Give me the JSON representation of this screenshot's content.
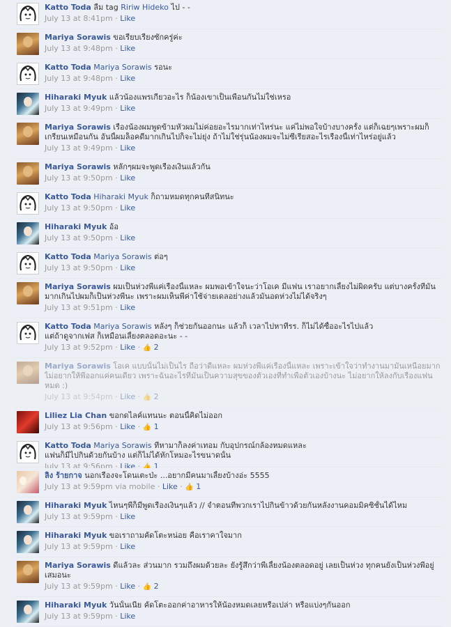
{
  "comments": [
    {
      "author": "Katto Toda",
      "tag": "",
      "text": "ลืม tag ",
      "tag2": "Ririw Hideko",
      "text2": " ไป - -",
      "time": "July 13 at 8:41pm",
      "via": "",
      "like": "Like",
      "likes": "",
      "avatar": "katto"
    },
    {
      "author": "Mariya Sorawis",
      "tag": "",
      "text": "ขอเรียบเรียงซักครู่ค่ะ",
      "tag2": "",
      "text2": "",
      "time": "July 13 at 9:48pm",
      "via": "",
      "like": "Like",
      "likes": "",
      "avatar": "mariya"
    },
    {
      "author": "Katto Toda",
      "tag": "Mariya Sorawis",
      "text": " รอนะ",
      "tag2": "",
      "text2": "",
      "time": "July 13 at 9:48pm",
      "via": "",
      "like": "Like",
      "likes": "",
      "avatar": "katto"
    },
    {
      "author": "Hiharaki Myuk",
      "tag": "",
      "text": "แล้วน้องแพรเกี่ยวอะไร ก็น้องเขาเป็นเพื่อนกันไม่ใช่เหรอ",
      "tag2": "",
      "text2": "",
      "time": "July 13 at 9:49pm",
      "via": "",
      "like": "Like",
      "likes": "",
      "avatar": "hiharaki"
    },
    {
      "author": "Mariya Sorawis",
      "tag": "",
      "text": "เรื่องน้องผมพูดข้ามหัวผมไม่ค่อยอะไรมากเท่าไหร่นะ แค่ไม่พอใจบ้างบางครั้ง แต่ก็เฉยๆเพราะผมก็",
      "line2": "เกรียนเหมือนกัน อันนี้ผมล็อคดีมากเกินไปก็จะไม่ยุ่ง ถ้าไม่ใช่รุ่นน้องผมจะไม่ซีเรียสอะไรเรื่องนี้เท่าไหร่อยู่แล้ว",
      "tag2": "",
      "text2": "",
      "time": "July 13 at 9:49pm",
      "via": "",
      "like": "Like",
      "likes": "",
      "avatar": "mariya"
    },
    {
      "author": "Mariya Sorawis",
      "tag": "",
      "text": "หลักๆผมจะพูดเรื่องเงินแล้วกัน",
      "tag2": "",
      "text2": "",
      "time": "July 13 at 9:50pm",
      "via": "",
      "like": "Like",
      "likes": "",
      "avatar": "mariya"
    },
    {
      "author": "Katto Toda",
      "tag": "Hiharaki Myuk",
      "text": " ก็ถามหมดทุกคนที่สนิทนะ",
      "tag2": "",
      "text2": "",
      "time": "July 13 at 9:50pm",
      "via": "",
      "like": "Like",
      "likes": "",
      "avatar": "katto"
    },
    {
      "author": "Hiharaki Myuk",
      "tag": "",
      "text": "อ้อ",
      "tag2": "",
      "text2": "",
      "time": "July 13 at 9:50pm",
      "via": "",
      "like": "Like",
      "likes": "",
      "avatar": "hiharaki"
    },
    {
      "author": "Katto Toda",
      "tag": "Mariya Sorawis",
      "text": " ต่อๆ",
      "tag2": "",
      "text2": "",
      "time": "July 13 at 9:50pm",
      "via": "",
      "like": "Like",
      "likes": "",
      "avatar": "katto"
    },
    {
      "author": "Mariya Sorawis",
      "tag": "",
      "text": "ผมเป็นห่วงพี่แค่เรื่องนี้แหละ ผมพอเข้าใจนะว่าโอเค มีแฟน เราอยากเลี้ยงไม่ผิดครับ แต่บางครั้งที่มัน",
      "line2": "มากเกินไปผมก็เป็นห่วงพี่นะ เพราะผมเห็นพี่ค่าใช้จ่ายเดลอย่างแล้วมันอดห่วงไม่ได้จริงๆ",
      "tag2": "",
      "text2": "",
      "time": "July 13 at 9:51pm",
      "via": "",
      "like": "Like",
      "likes": "",
      "avatar": "mariya"
    },
    {
      "author": "Katto Toda",
      "tag": "Mariya Sorawis",
      "text": " หลังๆ ก็ช่วยกันออกนะ แล้วก็ เวลาไปหาที่รร. ก็ไม่ได้ซื้ออะไรไปแล้ว",
      "line2": "แต่ถ้าดูจากเฟส ก็เหมือนเลี้ยงตลอดอะนะ - -",
      "tag2": "",
      "text2": "",
      "time": "July 13 at 9:52pm",
      "via": "",
      "like": "Like",
      "likes": "2",
      "avatar": "katto"
    },
    {
      "author": "Mariya Sorawis",
      "tag": "",
      "text": "โอเค แบบนั้นไม่เป็นไร ถือว่าดีแหละ ผมห่วงพี่แค่เรื่องนี้แหละ เพราะเข้าใจว่าทำงานมามันเหนื่อยมาก",
      "line2": "ไม่อยากให้พี่ออกแค่คนเดียว เพราะฉันอะไรที่มันเป็นความสุขของตัวเองที่ทำเพื่อตัวเองบ้างนะ ไม่อยากให้ลงกับเรื่องแฟน",
      "line3": "หมด :)",
      "tag2": "",
      "text2": "",
      "time": "July 13 at 9:54pm",
      "via": "",
      "like": "Like",
      "likes": "2",
      "avatar": "mariya"
    },
    {
      "author": "Liliez Lia Chan",
      "tag": "",
      "text": "ขอกดไลค์แทนนะ ตอนนี้คิดไม่ออก",
      "tag2": "",
      "text2": "",
      "time": "July 13 at 9:56pm",
      "via": "",
      "like": "Like",
      "likes": "1",
      "avatar": "liliez"
    },
    {
      "author": "Katto Toda",
      "tag": "Mariya Sorawis",
      "text": " ที่หามาก็ลงค่าเทอม กับอุปกรณ์กล้องหมดแหละ",
      "line2": "แฟนก็มีไปกินด้วยกันบ้าง แต่ก็ไม่ได้หักโหมอะไรขนาดนั้น",
      "tag2": "",
      "text2": "",
      "time": "July 13 at 9:56pm",
      "via": "",
      "like": "Like",
      "likes": "1",
      "avatar": "katto"
    },
    {
      "author": "ลิง ร้ายกาจ",
      "tag": "",
      "text": "นอกเรื่องจะโดนเตะป่ะ ...อยากมีคนมาเลี้ยงบ้างอ่ะ 5555",
      "tag2": "",
      "text2": "",
      "time": "July 13 at 9:59pm",
      "via": "via mobile",
      "like": "Like",
      "likes": "1",
      "avatar": "ling"
    },
    {
      "author": "Hiharaki Myuk",
      "tag": "",
      "text": "ไหนๆพี่ก็มีพูดเรื่องเงินๆแล้ว // จำตอนที่พวกเราไปกินข้าวด้วยกันหลังงานคอมมิคซิชั้นได้ไหม",
      "tag2": "",
      "text2": "",
      "time": "July 13 at 9:59pm",
      "via": "",
      "like": "Like",
      "likes": "",
      "avatar": "hiharaki"
    },
    {
      "author": "Hiharaki Myuk",
      "tag": "",
      "text": "ขอเราถามคัดโตะหน่อย คือเราคาใจมาก",
      "tag2": "",
      "text2": "",
      "time": "July 13 at 9:59pm",
      "via": "",
      "like": "Like",
      "likes": "",
      "avatar": "hiharaki"
    },
    {
      "author": "Mariya Sorawis",
      "tag": "",
      "text": "ดีแล้วละ ส่วนมาก รวมถึงผมด้วยละ ยังรู้สึกว่าพี่เลี้ยงน้องตลอดอยู่ เลยเป็นห่วง ทุกคนยังเป็นห่วงพี่อยู่",
      "line2": "เสมอนะ",
      "tag2": "",
      "text2": "",
      "time": "July 13 at 9:59pm",
      "via": "",
      "like": "Like",
      "likes": "2",
      "avatar": "mariya"
    },
    {
      "author": "Hiharaki Myuk",
      "tag": "",
      "text": "วันนั้นเนี่ย คัดโตะออกค่าอาหารให้น้องหมดเลยหรือเปล่า หรือแบ่งๆกันออก",
      "tag2": "",
      "text2": "",
      "time": "July 13 at 9:59pm",
      "via": "",
      "like": "Like",
      "likes": "",
      "avatar": "hiharaki"
    }
  ]
}
